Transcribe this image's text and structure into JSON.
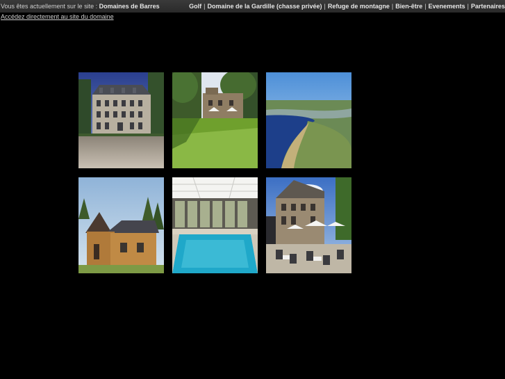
{
  "header": {
    "prefix": "Vous êtes actuellement sur le site :",
    "current_site": "Domaines de Barres",
    "nav": [
      {
        "label": "Golf"
      },
      {
        "label": "Domaine de la Gardille (chasse privée)"
      },
      {
        "label": "Refuge de montagne"
      },
      {
        "label": "Bien-être"
      },
      {
        "label": "Evenements"
      },
      {
        "label": "Partenaires"
      }
    ],
    "separator": "|"
  },
  "domain_link": "Accédez directement au site du domaine",
  "gallery": [
    {
      "name": "photo-chateau",
      "subject": "Stone château with slate roof and gravel courtyard"
    },
    {
      "name": "photo-golf-house",
      "subject": "Stone house with white umbrellas above a golf green"
    },
    {
      "name": "photo-lake",
      "subject": "Aerial view of a lake in a wooded valley"
    },
    {
      "name": "photo-wooden-refuge",
      "subject": "Wooden mountain refuge among pine trees"
    },
    {
      "name": "photo-indoor-pool",
      "subject": "Indoor swimming pool with lounge chairs"
    },
    {
      "name": "photo-terrace",
      "subject": "Stone building with restaurant terrace and umbrellas"
    }
  ]
}
